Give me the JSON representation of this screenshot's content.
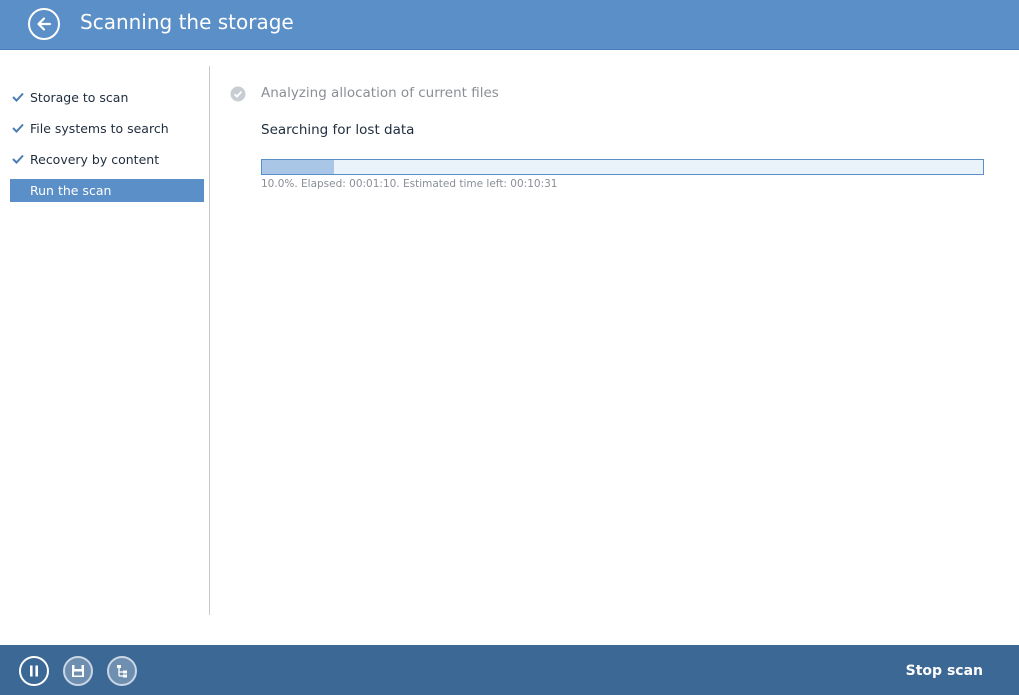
{
  "header": {
    "title": "Scanning the storage",
    "back_icon": "arrow-left-icon"
  },
  "sidebar": {
    "steps": [
      {
        "label": "Storage to scan",
        "completed": true,
        "active": false
      },
      {
        "label": "File systems to search",
        "completed": true,
        "active": false
      },
      {
        "label": "Recovery by content",
        "completed": true,
        "active": false
      },
      {
        "label": "Run the scan",
        "completed": false,
        "active": true
      }
    ]
  },
  "main": {
    "previous_task": "Analyzing allocation of current files",
    "current_task": "Searching for lost data",
    "progress_fraction": 0.1,
    "progress_text": "10.0%. Elapsed: 00:01:10. Estimated time left: 00:10:31"
  },
  "footer": {
    "icons": [
      "pause-icon",
      "save-icon",
      "tree-icon"
    ],
    "stop_label": "Stop scan"
  },
  "colors": {
    "accent": "#5b8fc7",
    "footer": "#3c6896",
    "progress_fill": "#a9c6e6"
  }
}
